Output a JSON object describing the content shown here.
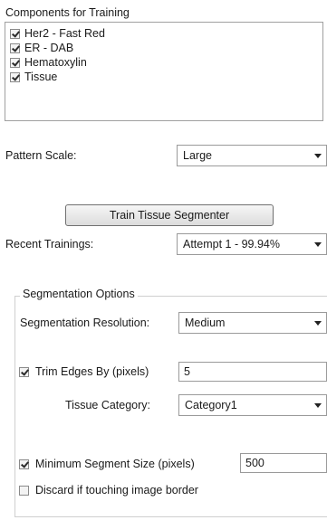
{
  "components": {
    "title": "Components for Training",
    "items": [
      {
        "label": "Her2 - Fast Red",
        "checked": true
      },
      {
        "label": "ER - DAB",
        "checked": true
      },
      {
        "label": "Hematoxylin",
        "checked": true
      },
      {
        "label": "Tissue",
        "checked": true
      }
    ]
  },
  "pattern_scale": {
    "label": "Pattern Scale:",
    "value": "Large"
  },
  "train_button": {
    "label": "Train Tissue Segmenter"
  },
  "recent_trainings": {
    "label": "Recent Trainings:",
    "value": "Attempt 1 - 99.94%"
  },
  "segmentation": {
    "group_title": "Segmentation Options",
    "resolution_label": "Segmentation Resolution:",
    "resolution_value": "Medium",
    "trim_edges": {
      "label": "Trim Edges By (pixels)",
      "checked": true,
      "value": "5"
    },
    "tissue_category": {
      "label": "Tissue Category:",
      "value": "Category1"
    },
    "min_segment": {
      "label": "Minimum Segment Size (pixels)",
      "checked": true,
      "value": "500"
    },
    "discard_border": {
      "label": "Discard if touching image border",
      "checked": false
    }
  }
}
